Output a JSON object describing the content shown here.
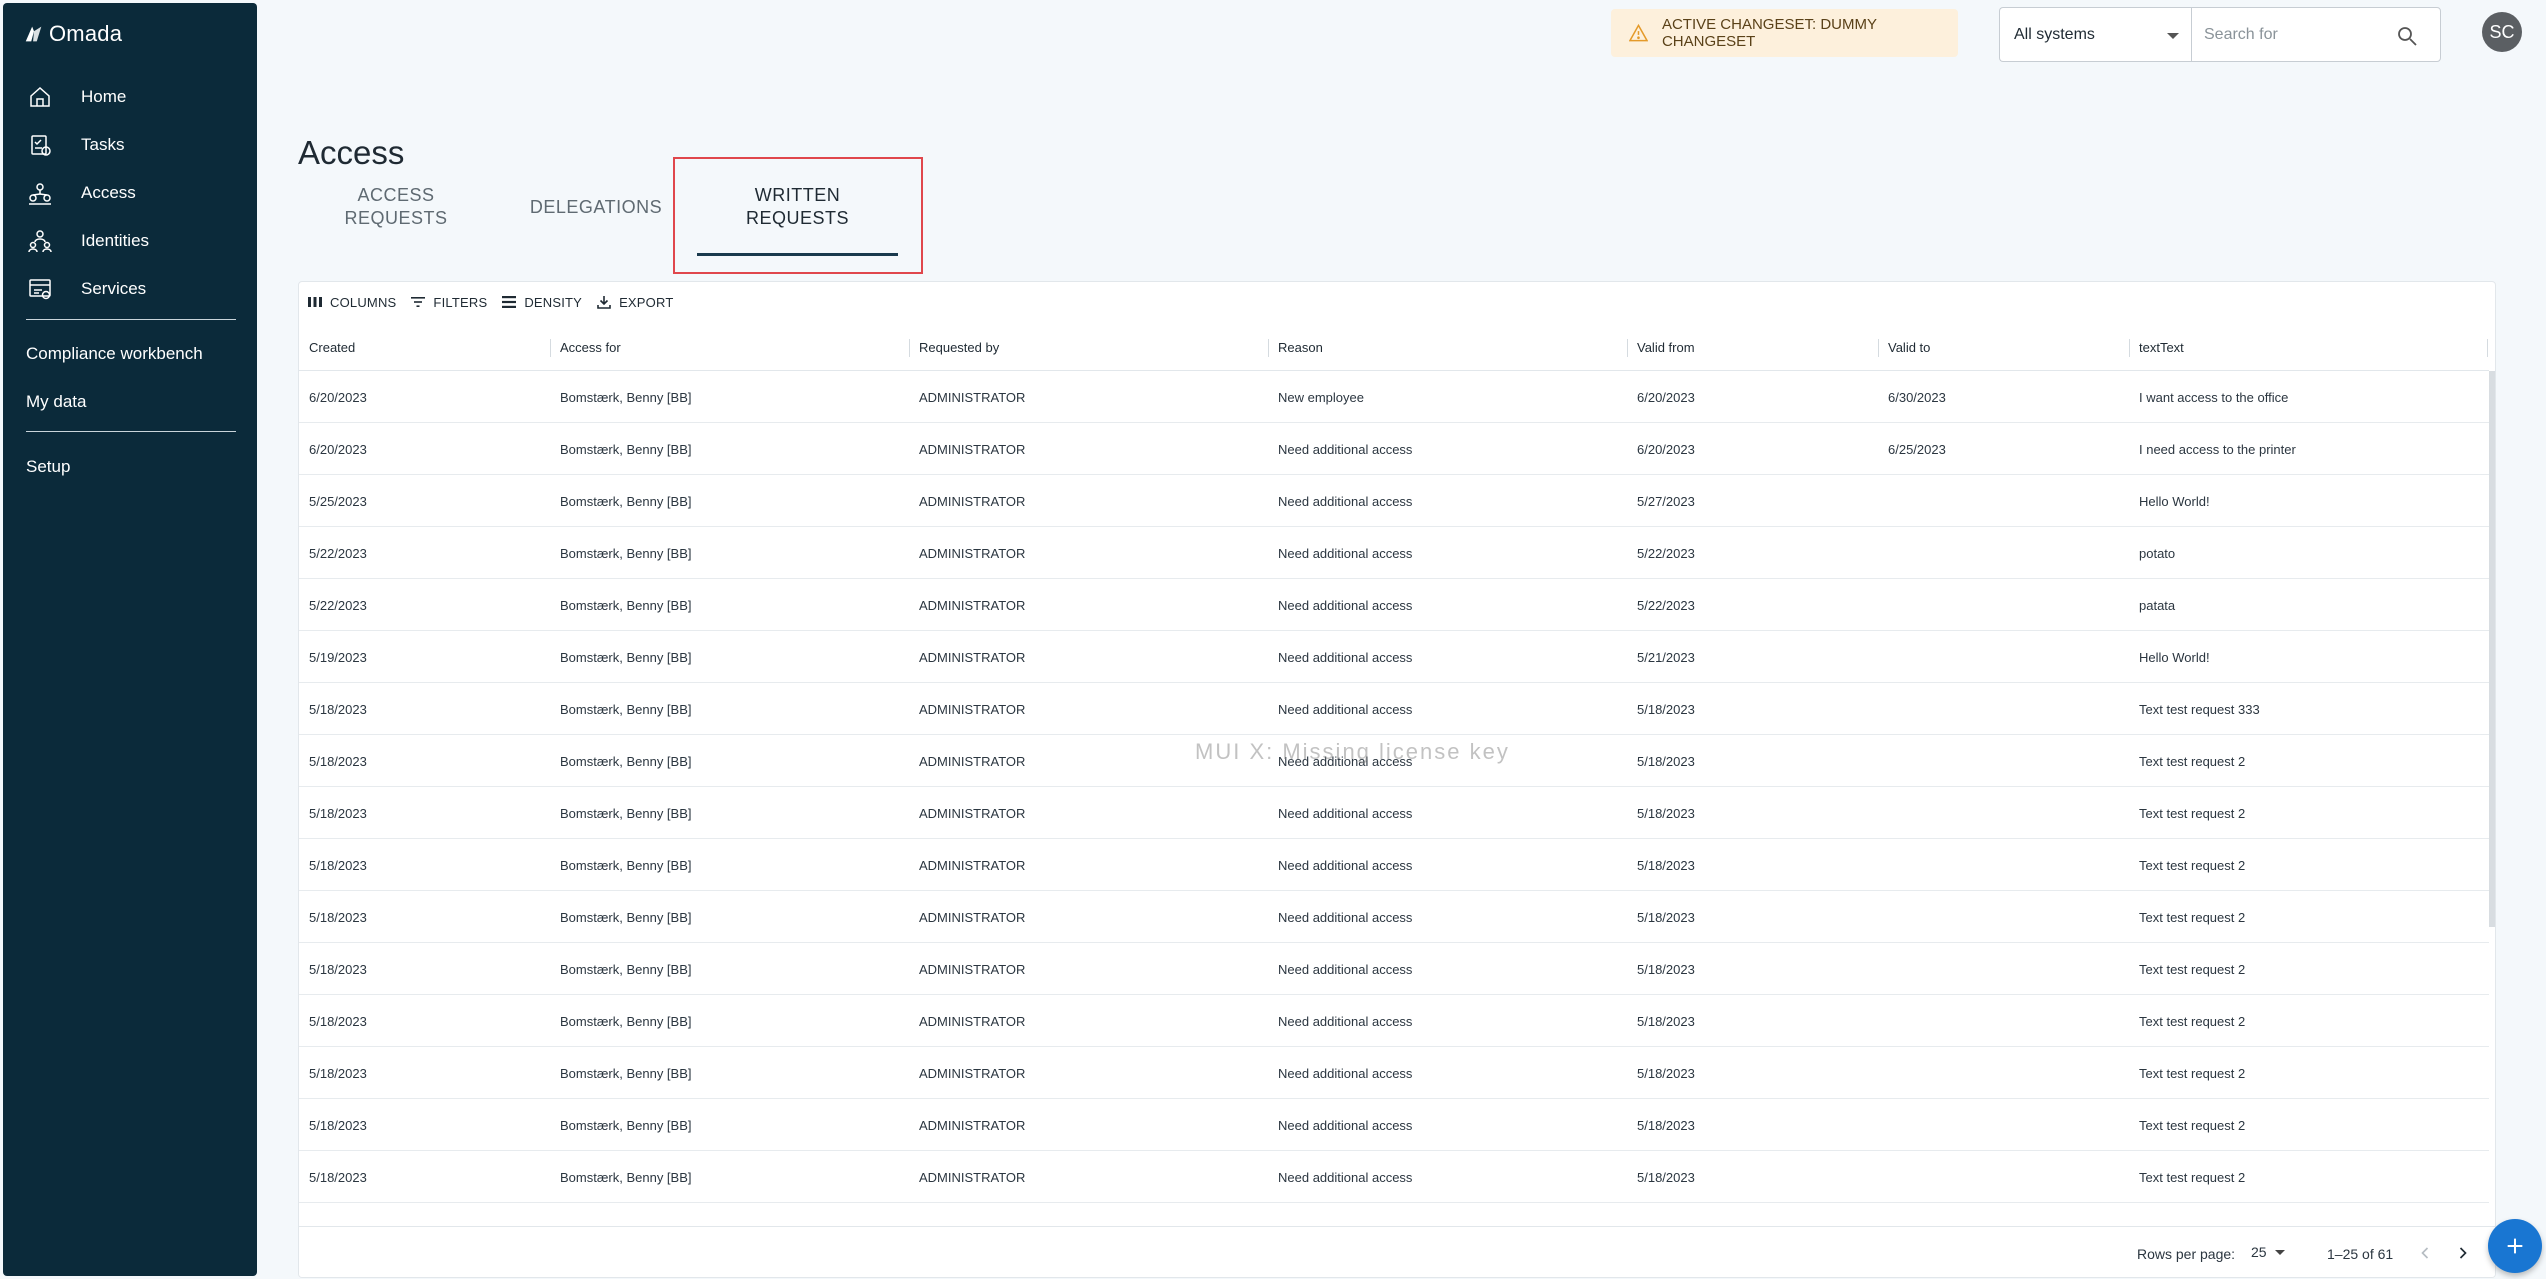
{
  "app": {
    "logo_text": "Omada"
  },
  "sidebar": {
    "items": [
      {
        "label": "Home",
        "icon": "home-icon"
      },
      {
        "label": "Tasks",
        "icon": "tasks-icon"
      },
      {
        "label": "Access",
        "icon": "access-icon"
      },
      {
        "label": "Identities",
        "icon": "identities-icon"
      },
      {
        "label": "Services",
        "icon": "services-icon"
      }
    ],
    "secondary": [
      "Compliance workbench",
      "My data"
    ],
    "tertiary": [
      "Setup"
    ]
  },
  "topbar": {
    "changeset_label": "ACTIVE CHANGESET: DUMMY CHANGESET",
    "system_select_value": "All systems",
    "search_placeholder": "Search for",
    "avatar_initials": "SC"
  },
  "page": {
    "title": "Access",
    "tabs": [
      {
        "line1": "ACCESS",
        "line2": "REQUESTS"
      },
      {
        "line1": "DELEGATIONS",
        "line2": ""
      },
      {
        "line1": "WRITTEN",
        "line2": "REQUESTS"
      }
    ],
    "active_tab": 2
  },
  "grid": {
    "toolbar": {
      "columns": "COLUMNS",
      "filters": "FILTERS",
      "density": "DENSITY",
      "export": "EXPORT"
    },
    "columns": [
      "Created",
      "Access for",
      "Requested by",
      "Reason",
      "Valid from",
      "Valid to",
      "textText"
    ],
    "rows": [
      [
        "6/20/2023",
        "Bomstærk, Benny [BB]",
        "ADMINISTRATOR",
        "New employee",
        "6/20/2023",
        "6/30/2023",
        "I want access to the office"
      ],
      [
        "6/20/2023",
        "Bomstærk, Benny [BB]",
        "ADMINISTRATOR",
        "Need additional access",
        "6/20/2023",
        "6/25/2023",
        "I need access to the printer"
      ],
      [
        "5/25/2023",
        "Bomstærk, Benny [BB]",
        "ADMINISTRATOR",
        "Need additional access",
        "5/27/2023",
        "",
        "Hello World!"
      ],
      [
        "5/22/2023",
        "Bomstærk, Benny [BB]",
        "ADMINISTRATOR",
        "Need additional access",
        "5/22/2023",
        "",
        "potato"
      ],
      [
        "5/22/2023",
        "Bomstærk, Benny [BB]",
        "ADMINISTRATOR",
        "Need additional access",
        "5/22/2023",
        "",
        "patata"
      ],
      [
        "5/19/2023",
        "Bomstærk, Benny [BB]",
        "ADMINISTRATOR",
        "Need additional access",
        "5/21/2023",
        "",
        "Hello World!"
      ],
      [
        "5/18/2023",
        "Bomstærk, Benny [BB]",
        "ADMINISTRATOR",
        "Need additional access",
        "5/18/2023",
        "",
        "Text test request 333"
      ],
      [
        "5/18/2023",
        "Bomstærk, Benny [BB]",
        "ADMINISTRATOR",
        "Need additional access",
        "5/18/2023",
        "",
        "Text test request 2"
      ],
      [
        "5/18/2023",
        "Bomstærk, Benny [BB]",
        "ADMINISTRATOR",
        "Need additional access",
        "5/18/2023",
        "",
        "Text test request 2"
      ],
      [
        "5/18/2023",
        "Bomstærk, Benny [BB]",
        "ADMINISTRATOR",
        "Need additional access",
        "5/18/2023",
        "",
        "Text test request 2"
      ],
      [
        "5/18/2023",
        "Bomstærk, Benny [BB]",
        "ADMINISTRATOR",
        "Need additional access",
        "5/18/2023",
        "",
        "Text test request 2"
      ],
      [
        "5/18/2023",
        "Bomstærk, Benny [BB]",
        "ADMINISTRATOR",
        "Need additional access",
        "5/18/2023",
        "",
        "Text test request 2"
      ],
      [
        "5/18/2023",
        "Bomstærk, Benny [BB]",
        "ADMINISTRATOR",
        "Need additional access",
        "5/18/2023",
        "",
        "Text test request 2"
      ],
      [
        "5/18/2023",
        "Bomstærk, Benny [BB]",
        "ADMINISTRATOR",
        "Need additional access",
        "5/18/2023",
        "",
        "Text test request 2"
      ],
      [
        "5/18/2023",
        "Bomstærk, Benny [BB]",
        "ADMINISTRATOR",
        "Need additional access",
        "5/18/2023",
        "",
        "Text test request 2"
      ],
      [
        "5/18/2023",
        "Bomstærk, Benny [BB]",
        "ADMINISTRATOR",
        "Need additional access",
        "5/18/2023",
        "",
        "Text test request 2"
      ]
    ],
    "footer": {
      "rows_per_page_label": "Rows per page:",
      "rows_per_page_value": "25",
      "range": "1–25 of 61"
    },
    "watermark": "MUI X: Missing license key"
  },
  "colors": {
    "sidebar_bg": "#0b2a3a",
    "accent": "#1976d2",
    "highlight": "#e0474c",
    "changeset_bg": "#fdf0dc"
  }
}
